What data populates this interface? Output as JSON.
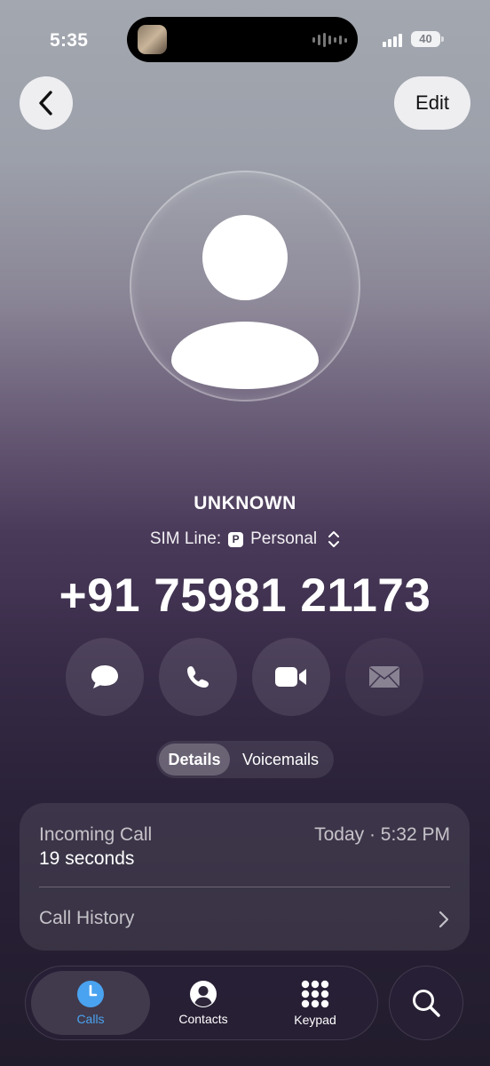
{
  "status_bar": {
    "time": "5:35",
    "battery": "40"
  },
  "header": {
    "back_icon": "chevron-left-icon",
    "edit_label": "Edit"
  },
  "contact": {
    "name": "UNKNOWN",
    "sim_label": "SIM Line:",
    "sim_badge": "P",
    "sim_name": "Personal",
    "phone": "+91 75981 21173"
  },
  "actions": [
    {
      "name": "message",
      "icon": "message-bubble-icon",
      "enabled": true
    },
    {
      "name": "call",
      "icon": "phone-icon",
      "enabled": true
    },
    {
      "name": "video",
      "icon": "video-camera-icon",
      "enabled": true
    },
    {
      "name": "mail",
      "icon": "envelope-icon",
      "enabled": false
    }
  ],
  "segment": {
    "details": "Details",
    "voicemails": "Voicemails",
    "selected": "Details"
  },
  "call_card": {
    "type": "Incoming Call",
    "duration": "19 seconds",
    "time": "Today · 5:32 PM",
    "history_label": "Call History"
  },
  "tabbar": {
    "calls": "Calls",
    "contacts": "Contacts",
    "keypad": "Keypad",
    "active": "Calls",
    "accent": "#4aa3f0"
  }
}
